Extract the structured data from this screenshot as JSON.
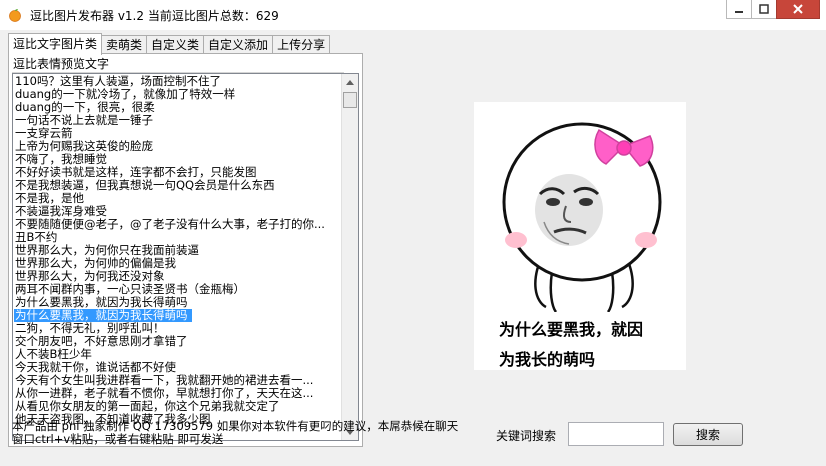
{
  "window": {
    "title": "逗比图片发布器 v1.2  当前逗比图片总数：629",
    "minimize_icon": "minimize-icon",
    "maximize_icon": "maximize-icon",
    "close_icon": "close-icon",
    "close_color": "#c7463a"
  },
  "tabs": [
    {
      "label": "逗比文字图片类",
      "active": true
    },
    {
      "label": "卖萌类",
      "active": false
    },
    {
      "label": "自定义类",
      "active": false
    },
    {
      "label": "自定义添加",
      "active": false
    },
    {
      "label": "上传分享",
      "active": false
    }
  ],
  "list": {
    "header": "逗比表情预览文字",
    "selected_index": 18,
    "selection_color": "#3399ff",
    "items": [
      "110吗？这里有人装逼，场面控制不住了",
      "duang的一下就冷场了，就像加了特效一样",
      "duang的一下，很亮，很柔",
      "一句话不说上去就是一锤子",
      "一支穿云箭",
      "上帝为何赐我这英俊的脸庞",
      "不嗨了，我想睡觉",
      "不好好读书就是这样，连字都不会打，只能发图",
      "不是我想装逼，但我真想说一句QQ会员是什么东西",
      "不是我，是他",
      "不装逼我浑身难受",
      "不要随随便便@老子，@了老子没有什么大事，老子打的你...",
      "丑B不约",
      "世界那么大，为何你只在我面前装逼",
      "世界那么大，为何帅的偏偏是我",
      "世界那么大，为何我还没对象",
      "两耳不闻群内事，一心只读圣贤书（金瓶梅）",
      "为什么要黑我，就因为我长得萌吗",
      "为什么要黑我，就因为我长得萌吗",
      "二狗，不得无礼，别呼乱叫！",
      "交个朋友吧，不好意思刚才拿错了",
      "人不装B枉少年",
      "今天我就干你，谁说话都不好使",
      "今天有个女生叫我进群看一下，我就翻开她的裙进去看一...",
      "从你一进群，老子就看不惯你，早就想打你了，天天在这...",
      "从看见你女朋友的第一面起，你这个兄弟我就交定了",
      "他天天盗我图，不知道收藏了我多少图"
    ]
  },
  "status_text": "本产品由 pnl 独家制作  QQ 17309579  如果你对本软件有更叼的建议，本屌恭候在聊天窗口ctrl+v粘贴，或者右键粘贴 即可发送",
  "preview": {
    "caption_line1": "为什么要黑我，就因",
    "caption_line2": "为我长的萌吗",
    "bow_color": "#ff5fc8"
  },
  "search": {
    "label": "关键词搜索",
    "value": "",
    "button_label": "搜索"
  }
}
